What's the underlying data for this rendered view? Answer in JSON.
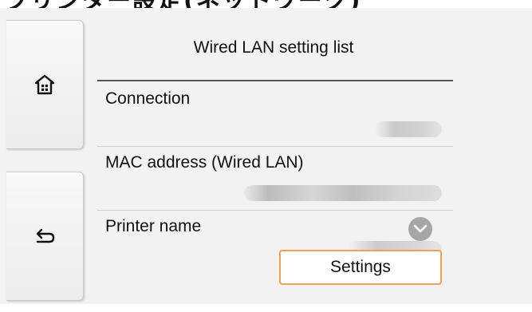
{
  "colors": {
    "screen_background": "#f2f2f2",
    "settings_button_border": "#f0a252",
    "scroll_button": "#a6a6a6"
  },
  "header": {
    "clipped_heading": "プリンター設定(ネットワーク)"
  },
  "sidebar": {
    "home_icon": "home-icon",
    "back_icon": "back-arrow-icon"
  },
  "list": {
    "title": "Wired LAN setting list",
    "items": [
      {
        "label": "Connection"
      },
      {
        "label": "MAC address (Wired LAN)"
      },
      {
        "label": "Printer name"
      }
    ]
  },
  "scroll": {
    "icon": "chevron-down-icon"
  },
  "actions": {
    "settings_label": "Settings"
  }
}
